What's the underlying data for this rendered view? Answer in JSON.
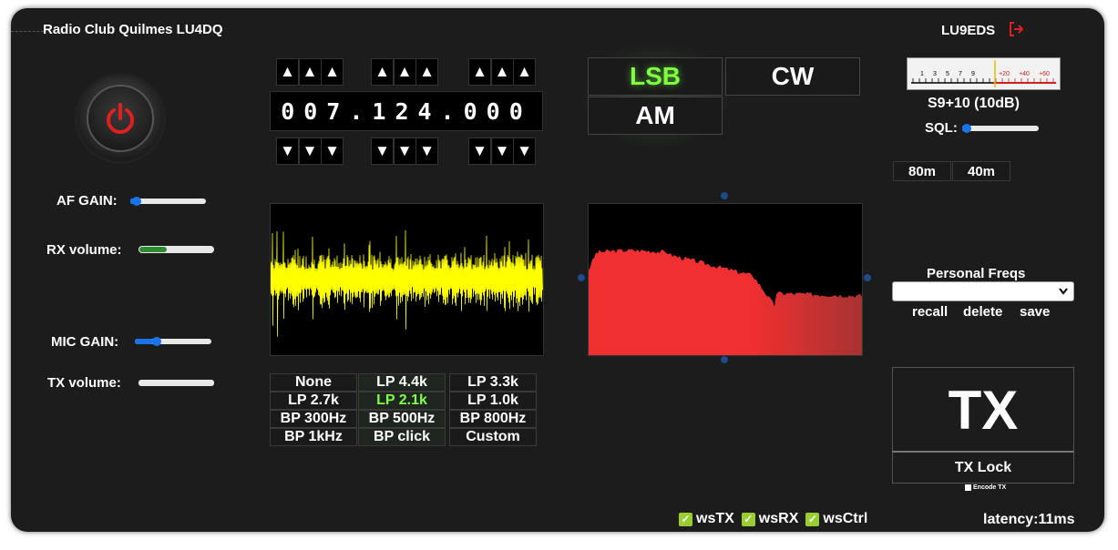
{
  "header": {
    "club_name": "Radio Club Quilmes LU4DQ",
    "user_callsign": "LU9EDS",
    "logout_icon": "logout-icon"
  },
  "power": {
    "icon": "power-icon",
    "state": "on",
    "color": "#e02020"
  },
  "audio": {
    "af_gain_label": "AF GAIN:",
    "af_gain_level": 0.05,
    "rx_volume_label": "RX volume:",
    "rx_volume_level": 0.36,
    "mic_gain_label": "MIC GAIN:",
    "mic_gain_level": 0.25,
    "tx_volume_label": "TX volume:",
    "tx_volume_level": 0.0
  },
  "frequency": {
    "display": "007.124.000",
    "up_arrow": "▲",
    "down_arrow": "▼"
  },
  "modes": {
    "items": [
      "LSB",
      "CW",
      "AM"
    ],
    "active": "LSB",
    "active_color": "#7fff3f"
  },
  "filters": {
    "items": [
      "None",
      "LP 4.4k",
      "LP 3.3k",
      "LP 2.7k",
      "LP 2.1k",
      "LP 1.0k",
      "BP 300Hz",
      "BP 500Hz",
      "BP 800Hz",
      "BP 1kHz",
      "BP click",
      "Custom"
    ],
    "active": "LP 2.1k",
    "active_color": "#7fff3f"
  },
  "smeter": {
    "scale_labels": [
      "1",
      "3",
      "5",
      "7",
      "9",
      "+20",
      "+40",
      "+60"
    ],
    "reading": "S9+10 (10dB)",
    "sql_label": "SQL:",
    "sql_level": 0.02
  },
  "bands": [
    "80m",
    "40m"
  ],
  "personal_freqs": {
    "title": "Personal Freqs",
    "selected": "",
    "recall": "recall",
    "delete": "delete",
    "save": "save"
  },
  "tx": {
    "button_label": "TX",
    "lock_label": "TX Lock",
    "encode_label": "Encode TX"
  },
  "status": {
    "checks": [
      "wsTX",
      "wsRX",
      "wsCtrl"
    ],
    "latency": "latency:11ms"
  },
  "colors": {
    "waveform": "#ffff00",
    "spectrum": "#f03030"
  }
}
